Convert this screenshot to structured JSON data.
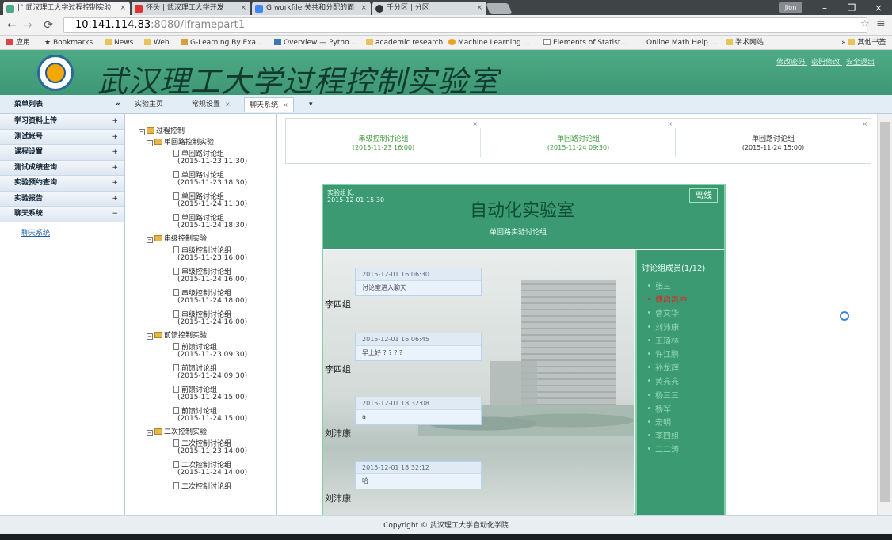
{
  "browser": {
    "tabs": [
      {
        "label": "|° 武汉理工大学过程控制实验",
        "active": true
      },
      {
        "label": "怀头 | 武汉理工大学开发",
        "active": false
      },
      {
        "label": "G workfile 关共和分配的面",
        "active": false
      },
      {
        "label": "千分区 | 分区",
        "active": false
      }
    ],
    "user_chip": "Jion",
    "url_host": "10.141.114.83",
    "url_rest": ":8080/iframepart1",
    "bookmarks": [
      "应用",
      "Bookmarks",
      "News",
      "Web",
      "G-Learning By Exa...",
      "Overview — Pytho...",
      "academic research",
      "Machine Learning ...",
      "Elements of Statist...",
      "Online Math Help ...",
      "学术网站",
      "其他书签"
    ]
  },
  "header": {
    "title": "武汉理工大学过程控制实验室",
    "links": [
      "修改密码",
      "密码修改",
      "安全退出"
    ]
  },
  "toolbar": {
    "menu_title": "菜单列表",
    "tabs": [
      {
        "label": "实验主页",
        "active": false,
        "closable": false
      },
      {
        "label": "常规设置",
        "active": false,
        "closable": true
      },
      {
        "label": "聊天系统",
        "active": true,
        "closable": true
      }
    ]
  },
  "sidebar": {
    "items": [
      {
        "label": "学习资料上传",
        "state": "+"
      },
      {
        "label": "测试帐号",
        "state": "+"
      },
      {
        "label": "课程设置",
        "state": "+"
      },
      {
        "label": "测试成绩查询",
        "state": "+"
      },
      {
        "label": "实验预约查询",
        "state": "+"
      },
      {
        "label": "实验报告",
        "state": "+"
      },
      {
        "label": "聊天系统",
        "state": "−"
      }
    ],
    "subitem": "聊天系统"
  },
  "tree": [
    {
      "type": "folder",
      "label": "过程控制",
      "level": 0
    },
    {
      "type": "folder",
      "label": "单回路控制实验",
      "level": 1
    },
    {
      "type": "doc",
      "label": "单回路讨论组",
      "date": "(2015-11-23 11:30)",
      "level": 2
    },
    {
      "type": "doc",
      "label": "单回路讨论组",
      "date": "(2015-11-23 18:30)",
      "level": 2
    },
    {
      "type": "doc",
      "label": "单回路讨论组",
      "date": "(2015-11-24 11:30)",
      "level": 2
    },
    {
      "type": "doc",
      "label": "单回路讨论组",
      "date": "(2015-11-24 18:30)",
      "level": 2
    },
    {
      "type": "folder",
      "label": "串级控制实验",
      "level": 1
    },
    {
      "type": "doc",
      "label": "串级控制讨论组",
      "date": "(2015-11-23 16:00)",
      "level": 2
    },
    {
      "type": "doc",
      "label": "串级控制讨论组",
      "date": "(2015-11-24 16:00)",
      "level": 2
    },
    {
      "type": "doc",
      "label": "串级控制讨论组",
      "date": "(2015-11-24 18:00)",
      "level": 2
    },
    {
      "type": "doc",
      "label": "串级控制讨论组",
      "date": "(2015-11-24 16:00)",
      "level": 2
    },
    {
      "type": "folder",
      "label": "前馈控制实验",
      "level": 1
    },
    {
      "type": "doc",
      "label": "前馈讨论组",
      "date": "(2015-11-23 09:30)",
      "level": 2
    },
    {
      "type": "doc",
      "label": "前馈讨论组",
      "date": "(2015-11-24 09:30)",
      "level": 2
    },
    {
      "type": "doc",
      "label": "前馈讨论组",
      "date": "(2015-11-24 15:00)",
      "level": 2
    },
    {
      "type": "doc",
      "label": "前馈讨论组",
      "date": "(2015-11-24 15:00)",
      "level": 2
    },
    {
      "type": "folder",
      "label": "二次控制实验",
      "level": 1
    },
    {
      "type": "doc",
      "label": "二次控制讨论组",
      "date": "(2015-11-23 14:00)",
      "level": 2
    },
    {
      "type": "doc",
      "label": "二次控制讨论组",
      "date": "(2015-11-24 14:00)",
      "level": 2
    },
    {
      "type": "doc",
      "label": "二次控制讨论组",
      "date": "",
      "level": 2
    }
  ],
  "chat_tabs": [
    {
      "name": "串级控制讨论组",
      "date": "(2015-11-23 16:00)",
      "current": false
    },
    {
      "name": "单回路讨论组",
      "date": "(2015-11-24 09:30)",
      "current": false
    },
    {
      "name": "单回路讨论组",
      "date": "(2015-11-24 15:00)",
      "current": true
    }
  ],
  "lab": {
    "name_label": "实验组长:",
    "name_value": "2015-12-01 15:30",
    "title": "自动化实验室",
    "subtitle": "单回路实验讨论组",
    "status": "离线"
  },
  "messages": [
    {
      "time": "2015-12-01 16:06:30",
      "text": "讨论室进入聊天",
      "speaker": "李四组"
    },
    {
      "time": "2015-12-01 16:06:45",
      "text": "早上好 ? ? ? ?",
      "speaker": "李四组"
    },
    {
      "time": "2015-12-01 18:32:08",
      "text": "a",
      "speaker": "刘沛康"
    },
    {
      "time": "2015-12-01 18:32:12",
      "text": "哈",
      "speaker": "刘沛康"
    }
  ],
  "members": {
    "title": "讨论组成员(1/12)",
    "list": [
      {
        "name": "张三",
        "online": false
      },
      {
        "name": "傅启凯冲",
        "online": true
      },
      {
        "name": "曹文华",
        "online": false
      },
      {
        "name": "刘沛康",
        "online": false
      },
      {
        "name": "王琦林",
        "online": false
      },
      {
        "name": "许江鹏",
        "online": false
      },
      {
        "name": "孙龙辉",
        "online": false
      },
      {
        "name": "黄亮亮",
        "online": false
      },
      {
        "name": "杨三三",
        "online": false
      },
      {
        "name": "杨军",
        "online": false
      },
      {
        "name": "宏明",
        "online": false
      },
      {
        "name": "李四组",
        "online": false
      },
      {
        "name": "二二涛",
        "online": false
      }
    ]
  },
  "footer": "Copyright © 武汉理工大学自动化学院",
  "colors": {
    "banner": "#3e9775",
    "accent_green": "#3c9a72",
    "online_red": "#e32020"
  }
}
